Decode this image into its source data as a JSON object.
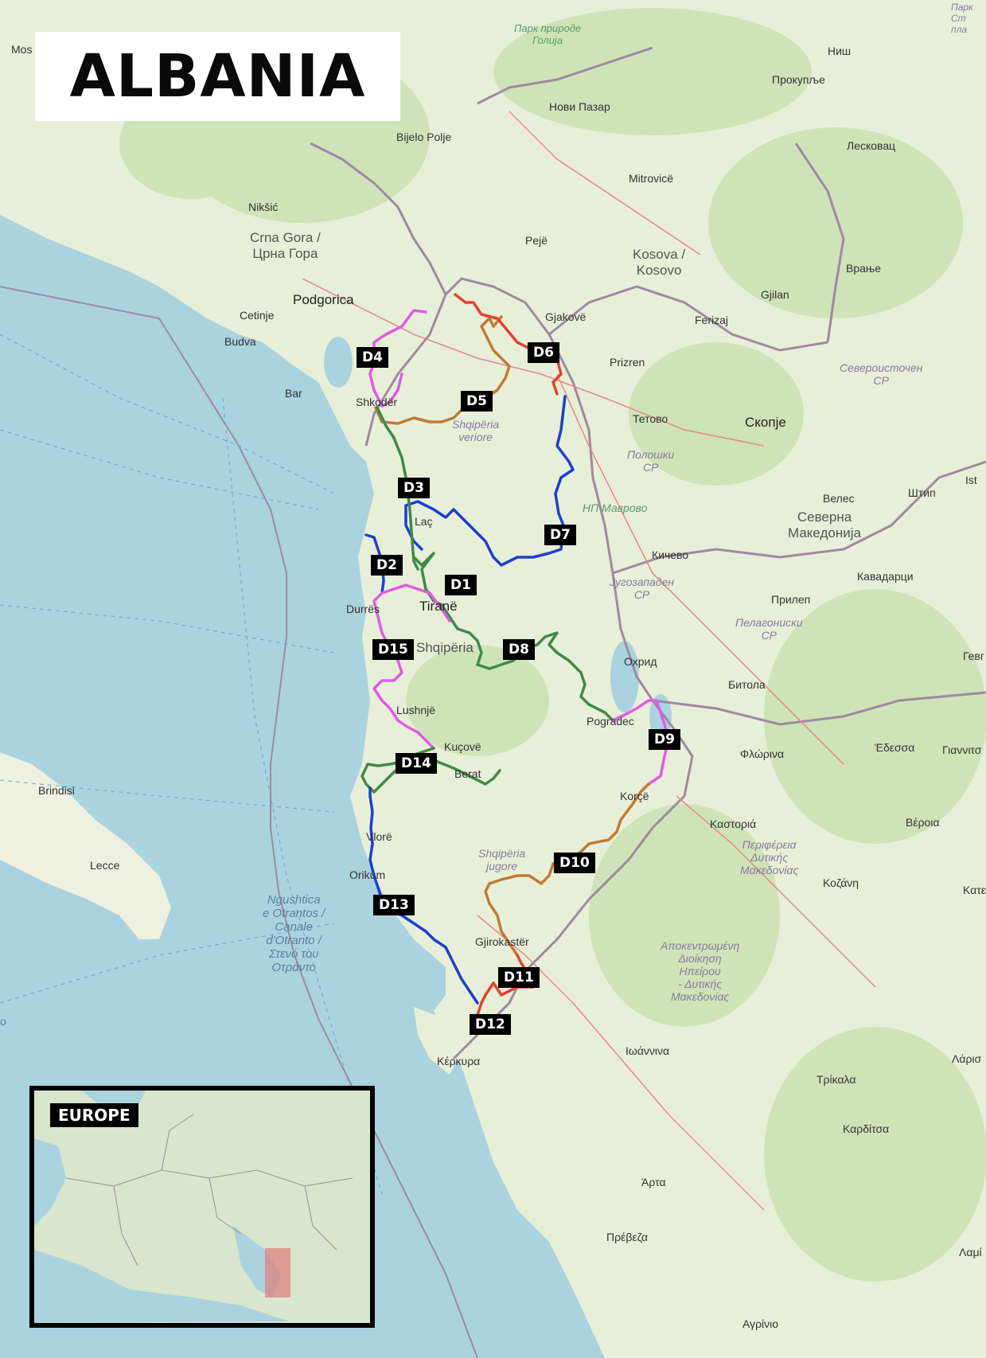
{
  "title": "ALBANIA",
  "route_colors": {
    "red": "#e2432f",
    "brown": "#c27a34",
    "blue": "#1c3ed6",
    "green": "#3f8a4a",
    "magenta": "#e05ce2"
  },
  "day_labels": [
    "D1",
    "D2",
    "D3",
    "D4",
    "D5",
    "D6",
    "D7",
    "D8",
    "D9",
    "D10",
    "D11",
    "D12",
    "D13",
    "D14",
    "D15"
  ],
  "places": {
    "park": "Парк природе\nГолија",
    "novi_pazar": "Нови Пазар",
    "nis": "Ниш",
    "prokuplje": "Прокупље",
    "bijelo_polje": "Bijelo Polje",
    "leskovac": "Лесковац",
    "mitrovice": "Mitrovicë",
    "niksic": "Nikšić",
    "crna_gora": "Crna Gora /\nЦрна Гора",
    "pejë": "Pejë",
    "kosova": "Kosova /\nKosovo",
    "vranje": "Врање",
    "podgorica": "Podgorica",
    "gjilan": "Gjilan",
    "cetinje": "Cetinje",
    "gjakove": "Gjakovë",
    "ferizaj": "Ferizaj",
    "budva": "Budva",
    "prizren": "Prizren",
    "bar": "Bar",
    "severo": "Североисточен\nСР",
    "shkoder": "Shkodër",
    "veriore": "Shqipëria\nveriore",
    "tetovo": "Тетово",
    "skopje": "Скопје",
    "poloshki": "Полошки\nСР",
    "np_mavrovo": "НП Маврово",
    "veles": "Велес",
    "shtip": "Штип",
    "severna": "Северна\nМакедонија",
    "lac": "Laç",
    "kicevo": "Кичево",
    "kavadarci": "Кавадарци",
    "jugozapaden": "Југозападен\nСР",
    "durres": "Durrës",
    "tirane": "Tiranë",
    "prilep": "Прилеп",
    "pelagonski": "Пелагониски\nСР",
    "shqiperia": "Shqipëria",
    "ohrid": "Охрид",
    "bitola": "Битола",
    "lushnje": "Lushnjë",
    "pogradec": "Pogradec",
    "kucove": "Kuçovë",
    "florina": "Φλώρινα",
    "edessa": "Έδεσσα",
    "berat": "Berat",
    "brindisi": "Brindisi",
    "korce": "Korçë",
    "kastoria": "Καστοριά",
    "veroia": "Βέροια",
    "vlore": "Vlorë",
    "jugore": "Shqipëria\njugore",
    "periferia": "Περιφέρεια\nΔυτικής\nΜακεδονίας",
    "lecce": "Lecce",
    "orikum": "Orikum",
    "kozani": "Κοζάνη",
    "otranto": "Ngushtica\ne Otrantos /\nCanale\nd'Otranto /\nΣτενό του\nΟτράντο",
    "gjirokaster": "Gjirokastër",
    "apokentromeni": "Αποκεντρωμένη\nΔιοίκηση\nΗπείρου\n- Δυτικής\nΜακεδονίας",
    "kerkyra": "Κέρκυρα",
    "ioannina": "Ιωάννινα",
    "trikala": "Τρίκαλα",
    "karditsa": "Καρδίτσα",
    "arta": "Άρτα",
    "preveza": "Πρέβεζα",
    "agrinio": "Αγρίνιο",
    "mos": "Mos",
    "ist": "Ist",
    "gevg": "Гевг",
    "giannitsa": "Γιαννιτσ",
    "kateri": "Κατε",
    "larisa": "Λάρισ",
    "lamia": "Λαμί",
    "park_st": "Парк\nСт\nпла",
    "o_left": "o"
  },
  "inset": {
    "label": "EUROPE"
  }
}
